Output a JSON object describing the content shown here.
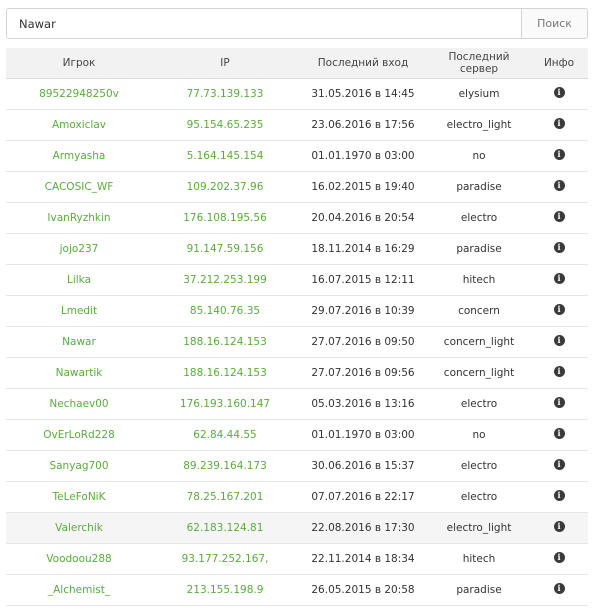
{
  "search": {
    "value": "Nawar",
    "button_label": "Поиск"
  },
  "table": {
    "headers": [
      "Игрок",
      "IP",
      "Последний вход",
      "Последний сервер",
      "Инфо"
    ],
    "rows": [
      {
        "player": "89522948250v",
        "ip": "77.73.139.133",
        "last_login": "31.05.2016 в 14:45",
        "server": "elysium"
      },
      {
        "player": "Amoxiclav",
        "ip": "95.154.65.235",
        "last_login": "23.06.2016 в 17:56",
        "server": "electro_light"
      },
      {
        "player": "Armyasha",
        "ip": "5.164.145.154",
        "last_login": "01.01.1970 в 03:00",
        "server": "no"
      },
      {
        "player": "CACOSIC_WF",
        "ip": "109.202.37.96",
        "last_login": "16.02.2015 в 19:40",
        "server": "paradise"
      },
      {
        "player": "IvanRyzhkin",
        "ip": "176.108.195.56",
        "last_login": "20.04.2016 в 20:54",
        "server": "electro"
      },
      {
        "player": "jojo237",
        "ip": "91.147.59.156",
        "last_login": "18.11.2014 в 16:29",
        "server": "paradise"
      },
      {
        "player": "Lilka",
        "ip": "37.212.253.199",
        "last_login": "16.07.2015 в 12:11",
        "server": "hitech"
      },
      {
        "player": "Lmedit",
        "ip": "85.140.76.35",
        "last_login": "29.07.2016 в 10:39",
        "server": "concern"
      },
      {
        "player": "Nawar",
        "ip": "188.16.124.153",
        "last_login": "27.07.2016 в 09:50",
        "server": "concern_light"
      },
      {
        "player": "Nawartik",
        "ip": "188.16.124.153",
        "last_login": "27.07.2016 в 09:56",
        "server": "concern_light"
      },
      {
        "player": "Nechaev00",
        "ip": "176.193.160.147",
        "last_login": "05.03.2016 в 13:16",
        "server": "electro"
      },
      {
        "player": "OvErLoRd228",
        "ip": "62.84.44.55",
        "last_login": "01.01.1970 в 03:00",
        "server": "no"
      },
      {
        "player": "Sanyag700",
        "ip": "89.239.164.173",
        "last_login": "30.06.2016 в 15:37",
        "server": "electro"
      },
      {
        "player": "TeLeFoNiK",
        "ip": "78.25.167.201",
        "last_login": "07.07.2016 в 22:17",
        "server": "electro"
      },
      {
        "player": "Valerchik",
        "ip": "62.183.124.81",
        "last_login": "22.08.2016 в 17:30",
        "server": "electro_light"
      },
      {
        "player": "Voodoou288",
        "ip": "93.177.252.167,",
        "last_login": "22.11.2014 в 18:34",
        "server": "hitech"
      },
      {
        "player": "_Alchemist_",
        "ip": "213.155.198.9",
        "last_login": "26.05.2015 в 20:58",
        "server": "paradise"
      }
    ],
    "hovered_row": 14,
    "info_icon": "info-circle-icon"
  },
  "colors": {
    "link": "#5aab3f",
    "header_bg": "#f2f2f2",
    "hover_bg": "#f5f5f5"
  }
}
